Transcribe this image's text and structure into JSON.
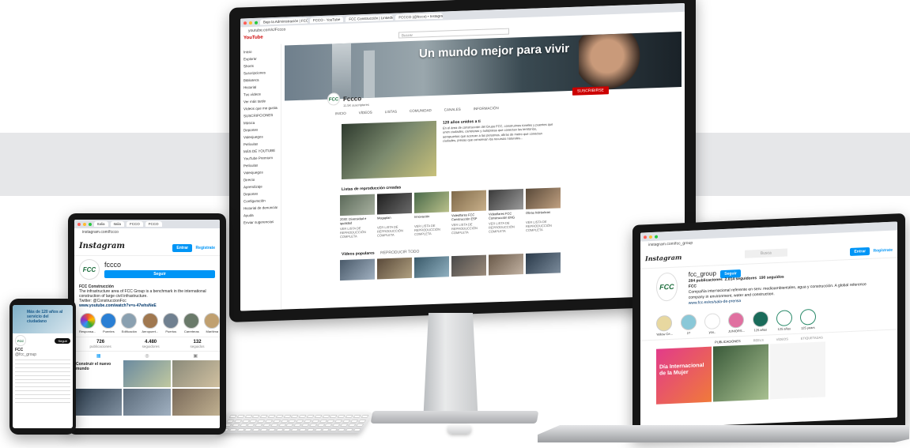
{
  "monitor": {
    "tabs": [
      "Bajo la Administración | FCC",
      "FCCO - YouTube",
      "FCC Construcción | LinkedIn",
      "FCCCO (@fccco) • Instagram"
    ],
    "url": "youtube.com/c/Fccco",
    "search_placeholder": "Buscar",
    "youtube_label": "YouTube",
    "sidebar": [
      "Inicio",
      "Explorar",
      "Shorts",
      "Suscripciones",
      "Biblioteca",
      "Historial",
      "Tus vídeos",
      "Ver más tarde",
      "Vídeos que me gustan",
      "SUSCRIPCIONES",
      "Música",
      "Deportes",
      "Videojuegos",
      "Películas",
      "MÁS DE YOUTUBE",
      "YouTube Premium",
      "Películas",
      "Videojuegos",
      "Directo",
      "Aprendizaje",
      "Deportes",
      "Configuración",
      "Historial de denuncias",
      "Ayuda",
      "Enviar sugerencias"
    ],
    "banner_text": "Un mundo mejor para vivir",
    "channel_name": "Fccco",
    "subscribers": "11.5K suscriptores",
    "subscribe_label": "SUSCRIBIRSE",
    "tabs_channel": [
      "INICIO",
      "VÍDEOS",
      "LISTAS",
      "COMUNIDAD",
      "CANALES",
      "INFORMACIÓN"
    ],
    "featured_title": "120 años unidos a ti",
    "featured_desc": "En el área de construcción del Grupo FCC, construimos túneles y puentes que unen ciudades, carreteras y autopistas que conectan los territorios, aeropuertos que acercan a las personas, obras de metro que conectan ciudades, presas que conservan los recursos naturales...",
    "playlists_title": "Listas de reproducción creadas",
    "playlists": [
      {
        "title": "2030: Diversidad e igualdad",
        "sub": "VER LISTA DE REPRODUCCIÓN COMPLETA"
      },
      {
        "title": "Megaplan",
        "sub": "VER LISTA DE REPRODUCCIÓN COMPLETA"
      },
      {
        "title": "Innovación",
        "sub": "VER LISTA DE REPRODUCCIÓN COMPLETA"
      },
      {
        "title": "Videoflares FCC Construcción ESP",
        "sub": "VER LISTA DE REPRODUCCIÓN COMPLETA"
      },
      {
        "title": "Videoflares FCC Construcción ENG",
        "sub": "VER LISTA DE REPRODUCCIÓN COMPLETA"
      },
      {
        "title": "Obras hidráulicas",
        "sub": "VER LISTA DE REPRODUCCIÓN COMPLETA"
      }
    ],
    "popular_title": "Vídeos populares",
    "play_all": "REPRODUCIR TODO"
  },
  "tablet": {
    "tabs": [
      "Italia",
      "Italia",
      "FCCO",
      "FCCO"
    ],
    "url": "instagram.com/fccco",
    "brand": "Instagram",
    "login": "Entrar",
    "register": "Regístrate",
    "username": "fccco",
    "follow": "Seguir",
    "bio_name": "FCC Construcción",
    "bio_text": "The infrastructure area of FCC Group is a benchmark in the international construction of large civil infrastructure.",
    "twitter": "Twitter: @ConstruccionFcc",
    "link": "www.youtube.com/watch?v=s-47whsNeE",
    "highlights": [
      "Responsa...",
      "Puentes",
      "Edificación",
      "Aeropuert...",
      "Puertos",
      "Carreteras",
      "Marítima"
    ],
    "stats": [
      {
        "n": "726",
        "l": "publicaciones"
      },
      {
        "n": "4.480",
        "l": "seguidores"
      },
      {
        "n": "132",
        "l": "seguidos"
      }
    ],
    "post_caption": "Construir el nuevo mundo"
  },
  "phone": {
    "hero_text": "Más de 120 años al servicio del ciudadano",
    "account": "FCC",
    "handle": "@fcc_group",
    "follow": "Seguir"
  },
  "laptop": {
    "url": "instagram.com/fcc_group",
    "brand": "Instagram",
    "search": "Busca",
    "login": "Entrar",
    "register": "Regístrate",
    "username": "fcc_group",
    "follow": "Seguir",
    "counts": [
      "284 publicaciones",
      "2.014 seguidores",
      "190 seguidos"
    ],
    "bio_name": "FCC",
    "bio_text": "Compañía internacional referente en serv. medioambientales, agua y construcción. A global reference company in environment, water and construction.",
    "bio_link": "www.fcc.es/es/sala-de-prensa",
    "highlights": [
      "Yellow Ce...",
      "27",
      "you..",
      "JUNIORS...",
      "125 años",
      "125 años",
      "125 years"
    ],
    "post_tabs": [
      "PUBLICACIONES",
      "REELS",
      "VÍDEOS",
      "ETIQUETADAS"
    ],
    "post1": "Día Internacional de la Mujer",
    "post1_big": "Mujer"
  },
  "colors": {
    "brand_green": "#1a6b3a",
    "yt_red": "#cc0000",
    "ig_blue": "#0095f6",
    "band": "#e6e7e9"
  }
}
